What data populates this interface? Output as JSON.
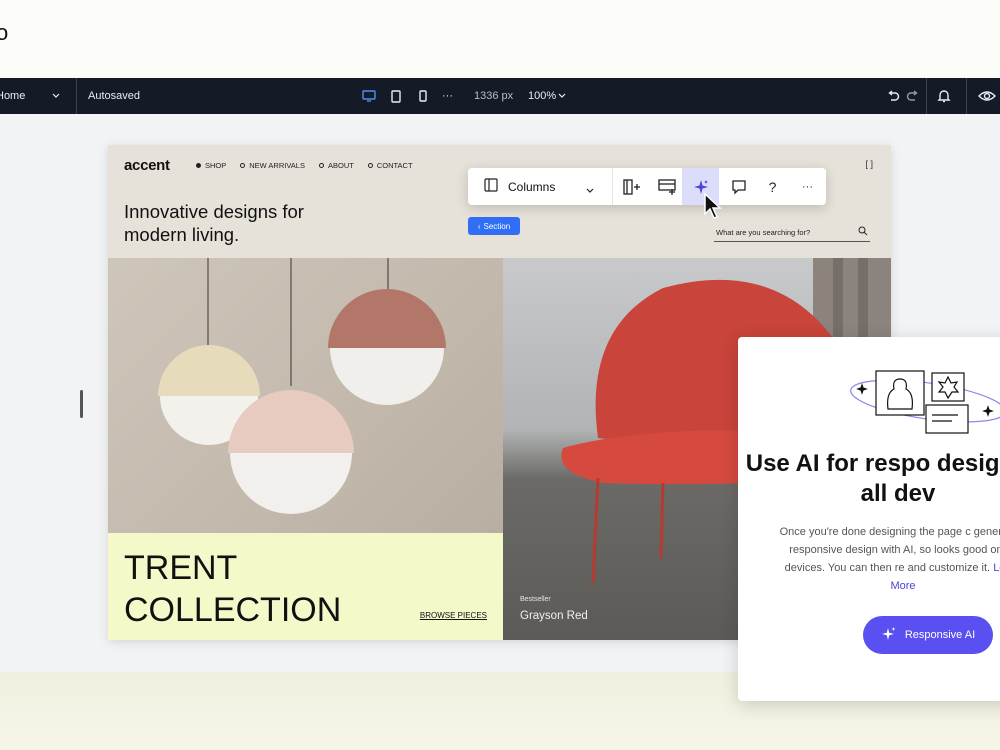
{
  "top_glyph": "o",
  "editor_bar": {
    "page_label": "Home",
    "status": "Autosaved",
    "width_label": "1336 px",
    "zoom_label": "100%",
    "more_label": "···"
  },
  "site": {
    "logo": "accent",
    "nav": [
      "SHOP",
      "NEW ARRIVALS",
      "ABOUT",
      "CONTACT"
    ],
    "corner_brackets": "[ ]",
    "tagline": "Innovative designs for modern living.",
    "search_placeholder": "What are you searching for?",
    "collection_title": "TRENT COLLECTION",
    "browse_link": "BROWSE PIECES",
    "product_tag": "Bestseller",
    "product_name": "Grayson Red"
  },
  "section_chip": "Section",
  "floating_toolbar": {
    "layout_label": "Columns",
    "more_label": "···",
    "help_label": "?"
  },
  "ai_card": {
    "title": "Use AI for respo design on all dev",
    "body": "Once you're done designing the page c generate a responsive design with AI, so looks good on all devices. You can then re and customize it.",
    "link": "Learn More",
    "cta": "Responsive AI"
  },
  "colors": {
    "editor_bar": "#151b26",
    "accent_blue": "#2f6ef5",
    "ai_purple": "#5a4ff0",
    "active_tool_bg": "#dcdcfb",
    "collection_bg": "#f5f8c8"
  }
}
